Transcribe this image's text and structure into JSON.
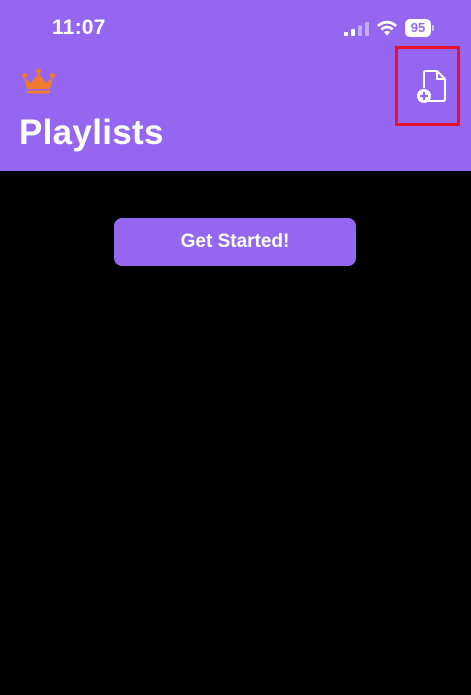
{
  "status_bar": {
    "time": "11:07",
    "battery_level": "95"
  },
  "header": {
    "title": "Playlists",
    "crown_icon": "crown-icon",
    "add_file_icon": "document-add-icon"
  },
  "main": {
    "get_started_label": "Get Started!"
  },
  "colors": {
    "header_bg": "#9567f0",
    "button_bg": "#9567f0",
    "crown": "#f07a2e",
    "highlight": "#e8112d",
    "background": "#000000"
  }
}
